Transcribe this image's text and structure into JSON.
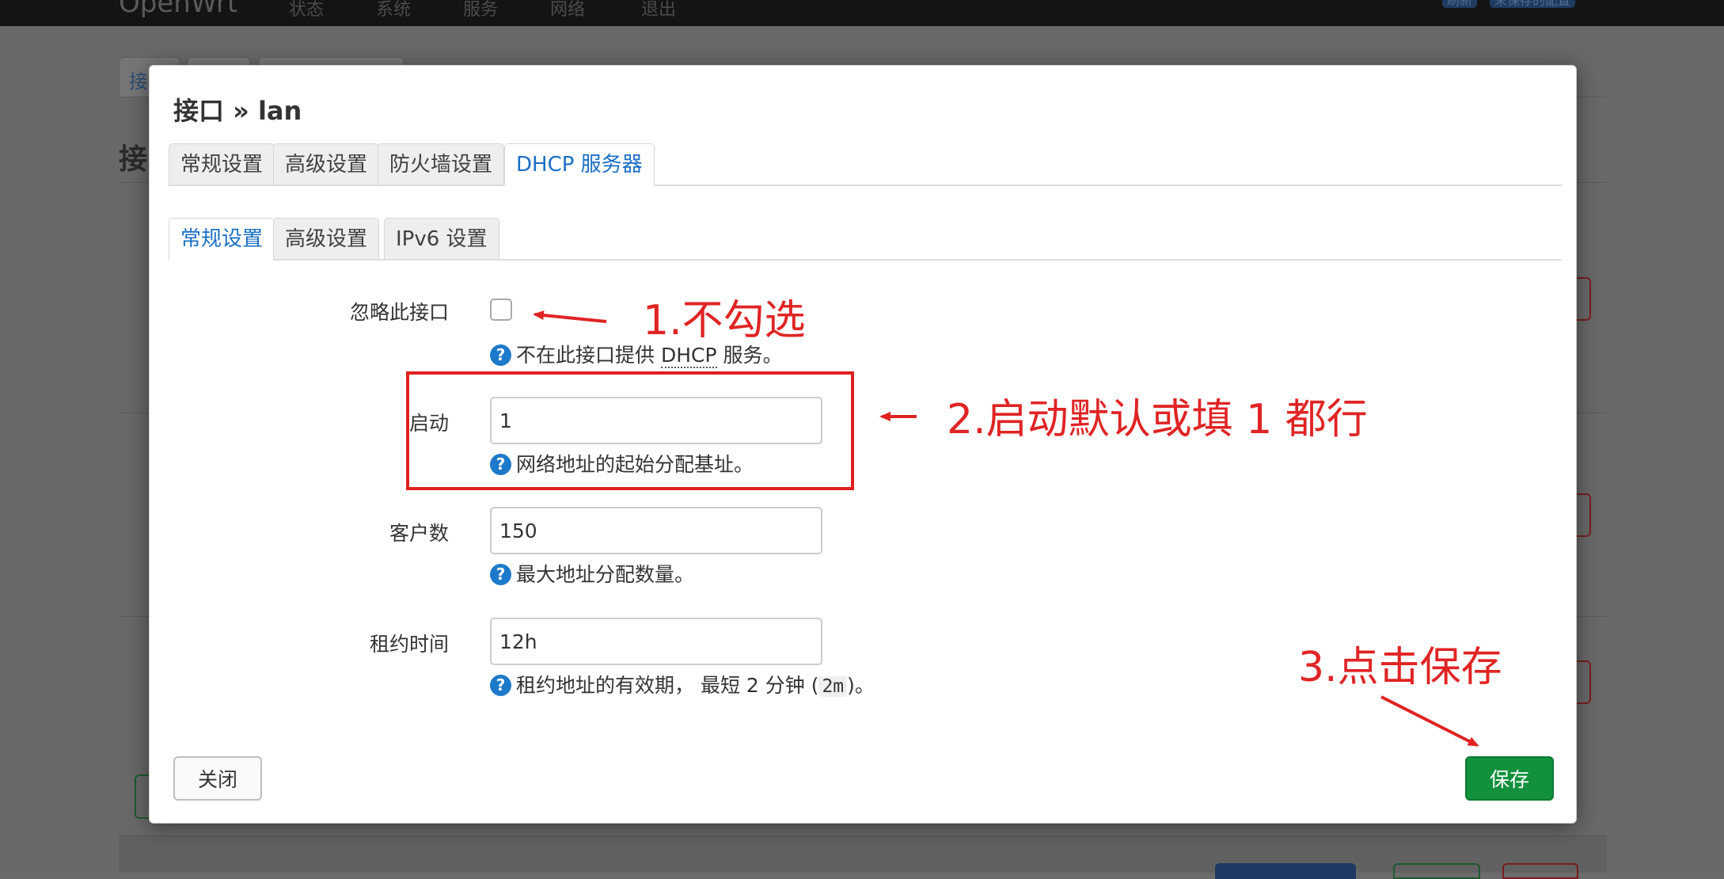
{
  "background": {
    "brand": "OpenWrt",
    "nav": [
      "状态",
      "系统",
      "服务",
      "网络",
      "退出"
    ],
    "pills": [
      "刷新",
      "未保存的配置"
    ],
    "tab_prefix": "接",
    "title_prefix": "接"
  },
  "modal": {
    "title": "接口 » lan",
    "outer_tabs": [
      "常规设置",
      "高级设置",
      "防火墙设置",
      "DHCP 服务器"
    ],
    "inner_tabs": [
      "常规设置",
      "高级设置",
      "IPv6 设置"
    ],
    "fields": {
      "ignore": {
        "label": "忽略此接口",
        "checked": false,
        "help_prefix": "不在此接口提供 ",
        "help_abbr": "DHCP",
        "help_suffix": " 服务。"
      },
      "start": {
        "label": "启动",
        "value": "1",
        "help": "网络地址的起始分配基址。"
      },
      "limit": {
        "label": "客户数",
        "value": "150",
        "help": "最大地址分配数量。"
      },
      "leasetime": {
        "label": "租约时间",
        "value": "12h",
        "help_prefix": "租约地址的有效期， 最短 2 分钟 (",
        "help_code": "2m",
        "help_suffix": ")。"
      }
    },
    "buttons": {
      "close": "关闭",
      "save": "保存"
    }
  },
  "annotations": {
    "step1": "1.不勾选",
    "step2": "2.启动默认或填 1 都行",
    "step3": "3.点击保存",
    "color": "#e02424"
  },
  "colors": {
    "accent": "#1a6fc4",
    "save_button": "#12913d",
    "help_icon": "#1d79c9"
  }
}
